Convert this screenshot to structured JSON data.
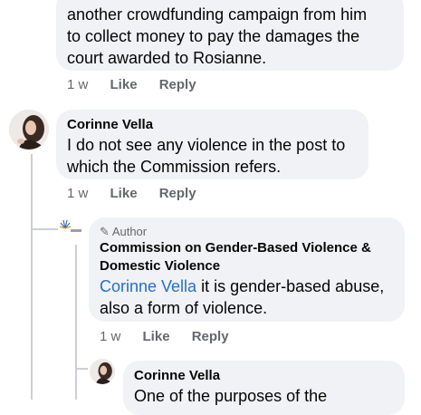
{
  "comment1": {
    "text_lines": [
      "another crowdfunding campaign from him",
      "to collect money to pay the damages the",
      "court awarded to Rosianne."
    ],
    "time": "1 w",
    "like": "Like",
    "reply": "Reply"
  },
  "comment2": {
    "author": "Corinne Vella",
    "text_lines": [
      "I do not see any violence in the post to",
      "which the Commission refers."
    ],
    "time": "1 w",
    "like": "Like",
    "reply": "Reply"
  },
  "comment3": {
    "badge": "Author",
    "author_lines": [
      "Commission on Gender-Based Violence &",
      "Domestic Violence"
    ],
    "mention": "Corinne Vella",
    "text_rest": " it is gender-based abuse,",
    "text_line2": "also a form of violence.",
    "time": "1 w",
    "like": "Like",
    "reply": "Reply"
  },
  "comment4": {
    "author": "Corinne Vella",
    "text_partial": "One of the purposes of the"
  },
  "colors": {
    "bubble": "#f0f2f5",
    "meta_text": "#65676b",
    "mention": "#2470c9",
    "thread_line": "#ccd0d5"
  }
}
